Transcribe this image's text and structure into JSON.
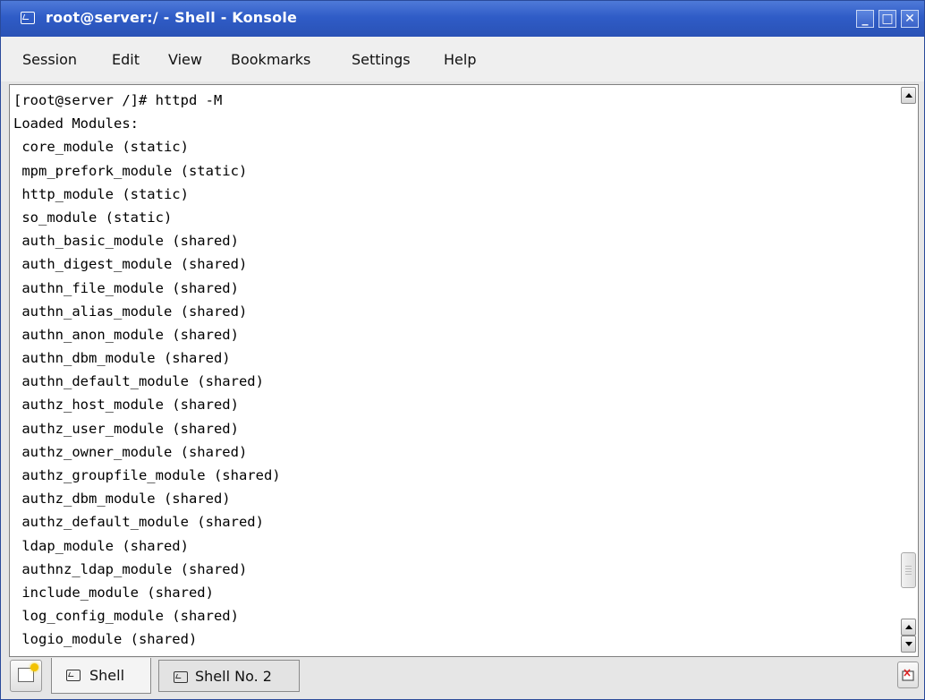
{
  "window": {
    "title": "root@server:/ - Shell - Konsole",
    "minimize": "_",
    "maximize": "□",
    "close": "✕"
  },
  "menu": [
    "Session",
    "Edit",
    "View",
    "Bookmarks",
    "Settings",
    "Help"
  ],
  "terminal": {
    "lines": [
      "[root@server /]# httpd -M",
      "Loaded Modules:",
      " core_module (static)",
      " mpm_prefork_module (static)",
      " http_module (static)",
      " so_module (static)",
      " auth_basic_module (shared)",
      " auth_digest_module (shared)",
      " authn_file_module (shared)",
      " authn_alias_module (shared)",
      " authn_anon_module (shared)",
      " authn_dbm_module (shared)",
      " authn_default_module (shared)",
      " authz_host_module (shared)",
      " authz_user_module (shared)",
      " authz_owner_module (shared)",
      " authz_groupfile_module (shared)",
      " authz_dbm_module (shared)",
      " authz_default_module (shared)",
      " ldap_module (shared)",
      " authnz_ldap_module (shared)",
      " include_module (shared)",
      " log_config_module (shared)",
      " logio_module (shared)"
    ]
  },
  "tabs": [
    {
      "label": "Shell",
      "active": true
    },
    {
      "label": "Shell No. 2",
      "active": false
    }
  ],
  "colors": {
    "titlebar": "#2f5cc7",
    "terminal_bg": "#ffffff",
    "terminal_fg": "#000000"
  }
}
